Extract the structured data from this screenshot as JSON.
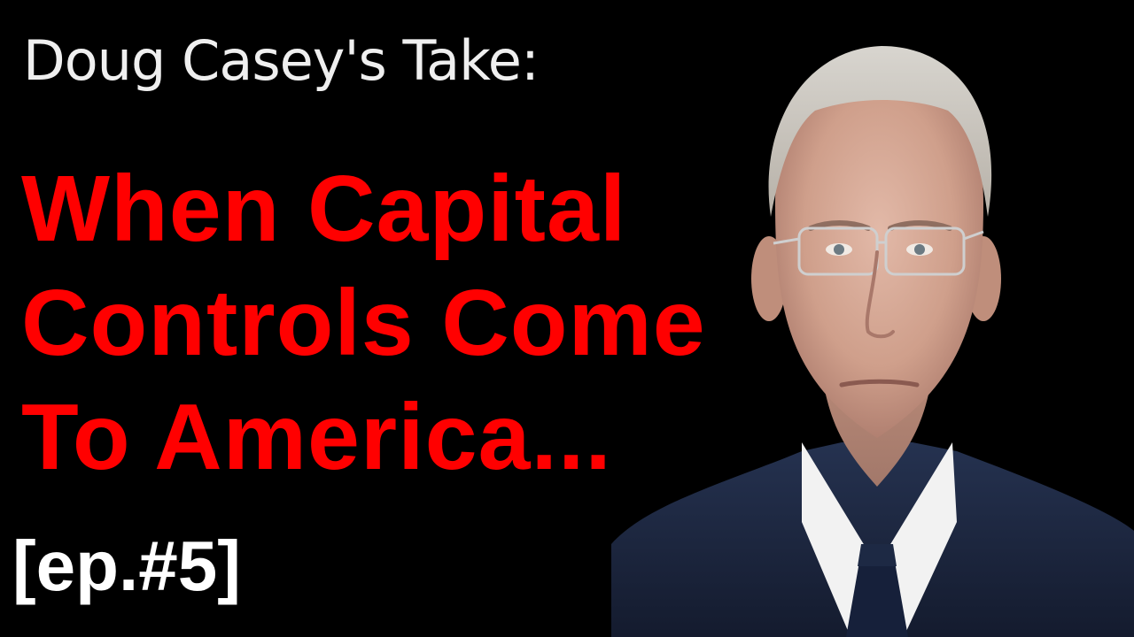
{
  "thumbnail": {
    "kicker": "Doug Casey's Take:",
    "headline_lines": [
      "When Capital",
      "Controls Come",
      "To America..."
    ],
    "episode_tag": "[ep.#5]"
  },
  "colors": {
    "background": "#000000",
    "kicker_text": "#efefef",
    "headline_text": "#ff0000",
    "episode_text": "#ffffff"
  }
}
